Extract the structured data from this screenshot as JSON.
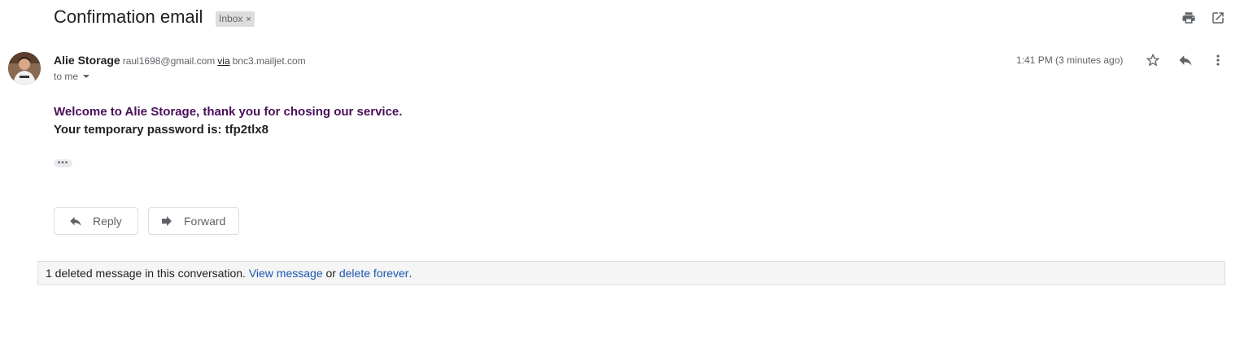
{
  "email": {
    "subject": "Confirmation email",
    "label": "Inbox",
    "label_remove": "×",
    "sender_name": "Alie Storage",
    "sender_email": "raul1698@gmail.com",
    "via_label": "via",
    "via_domain": "bnc3.mailjet.com",
    "to_label": "to me",
    "timestamp": "1:41 PM (3 minutes ago)",
    "body_line1": "Welcome to Alie Storage, thank you for chosing our service.",
    "body_line2": "Your temporary password is: tfp2tlx8",
    "trimmed_content": "•••"
  },
  "actions": {
    "reply_label": "Reply",
    "forward_label": "Forward"
  },
  "deleted_notice": {
    "prefix": "1 deleted message in this conversation.",
    "view_link": "View message",
    "conjunction": "or",
    "delete_link": "delete forever",
    "suffix": "."
  },
  "icons": {
    "print": "print-icon",
    "open_new_window": "open-in-new-window-icon",
    "star": "star-icon",
    "reply": "reply-icon",
    "more": "more-vert-icon",
    "forward": "forward-icon"
  },
  "colors": {
    "body_highlight": "#4a0f5a",
    "link": "#1a56b0",
    "chip_bg": "#dddddd"
  }
}
